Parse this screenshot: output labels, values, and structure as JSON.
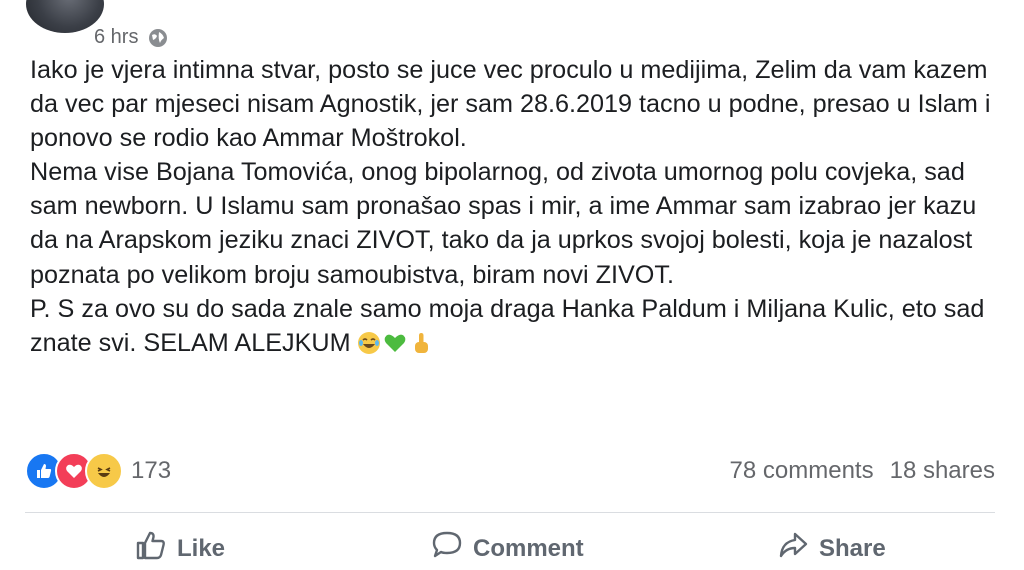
{
  "header": {
    "time": "6 hrs",
    "privacy_icon": "globe-icon"
  },
  "post": {
    "paragraphs": [
      "Iako je vjera intimna stvar, posto se juce vec proculo u medijima, Zelim da vam kazem da vec par mjeseci nisam Agnostik, jer sam 28.6.2019 tacno u podne, presao u Islam i ponovo se rodio kao Ammar Moštrokol.",
      "Nema vise Bojana Tomovića, onog bipolarnog, od zivota umornog polu covjeka, sad sam newborn. U Islamu sam pronašao spas i mir, a ime Ammar sam izabrao jer kazu da na Arapskom jeziku znaci ZIVOT, tako da ja uprkos svojoj bolesti, koja je nazalost poznata po velikom broju samoubistva, biram novi ZIVOT.",
      "P. S za ovo su do sada znale samo moja draga Hanka Paldum i Miljana Kulic, eto sad znate svi. SELAM ALEJKUM"
    ],
    "trailing_emojis": [
      "tears-of-joy-emoji",
      "green-heart-emoji",
      "pointing-up-emoji"
    ]
  },
  "engagement": {
    "reaction_icons": [
      "like-reaction",
      "love-reaction",
      "haha-reaction"
    ],
    "reaction_count": "173",
    "comments": "78 comments",
    "shares": "18 shares"
  },
  "actions": {
    "like": "Like",
    "comment": "Comment",
    "share": "Share"
  },
  "colors": {
    "like_blue": "#1877f2",
    "love_red": "#f33e58",
    "haha_yellow": "#f7c948",
    "secondary_text": "#65676b"
  }
}
